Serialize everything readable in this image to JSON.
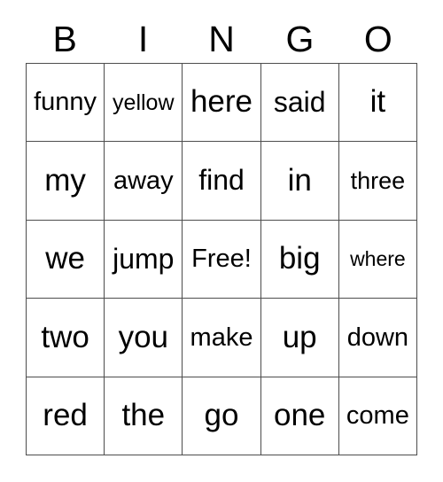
{
  "card": {
    "title": "BINGO",
    "header": {
      "letters": [
        "B",
        "I",
        "N",
        "G",
        "O"
      ]
    },
    "free_space_label": "Free!",
    "free_space_position": {
      "row": 3,
      "column": 3
    },
    "grid": {
      "rows": 5,
      "columns": 5,
      "border_color": "#4d4d4d",
      "background_color": "#ffffff",
      "text_color": "#000000",
      "cells": [
        [
          {
            "text": "funny",
            "size": "l"
          },
          {
            "text": "yellow",
            "size": "s"
          },
          {
            "text": "here",
            "size": "xxl"
          },
          {
            "text": "said",
            "size": "xl"
          },
          {
            "text": "it",
            "size": "xxl"
          }
        ],
        [
          {
            "text": "my",
            "size": "xxl"
          },
          {
            "text": "away",
            "size": "l"
          },
          {
            "text": "find",
            "size": "xl"
          },
          {
            "text": "in",
            "size": "xxl"
          },
          {
            "text": "three",
            "size": "m"
          }
        ],
        [
          {
            "text": "we",
            "size": "xxl"
          },
          {
            "text": "jump",
            "size": "xl"
          },
          {
            "text": "Free!",
            "size": "l"
          },
          {
            "text": "big",
            "size": "xxl"
          },
          {
            "text": "where",
            "size": "xs"
          }
        ],
        [
          {
            "text": "two",
            "size": "xxl"
          },
          {
            "text": "you",
            "size": "xxl"
          },
          {
            "text": "make",
            "size": "l"
          },
          {
            "text": "up",
            "size": "xxl"
          },
          {
            "text": "down",
            "size": "l"
          }
        ],
        [
          {
            "text": "red",
            "size": "xxl"
          },
          {
            "text": "the",
            "size": "xxl"
          },
          {
            "text": "go",
            "size": "xxl"
          },
          {
            "text": "one",
            "size": "xxl"
          },
          {
            "text": "come",
            "size": "l"
          }
        ]
      ]
    }
  }
}
